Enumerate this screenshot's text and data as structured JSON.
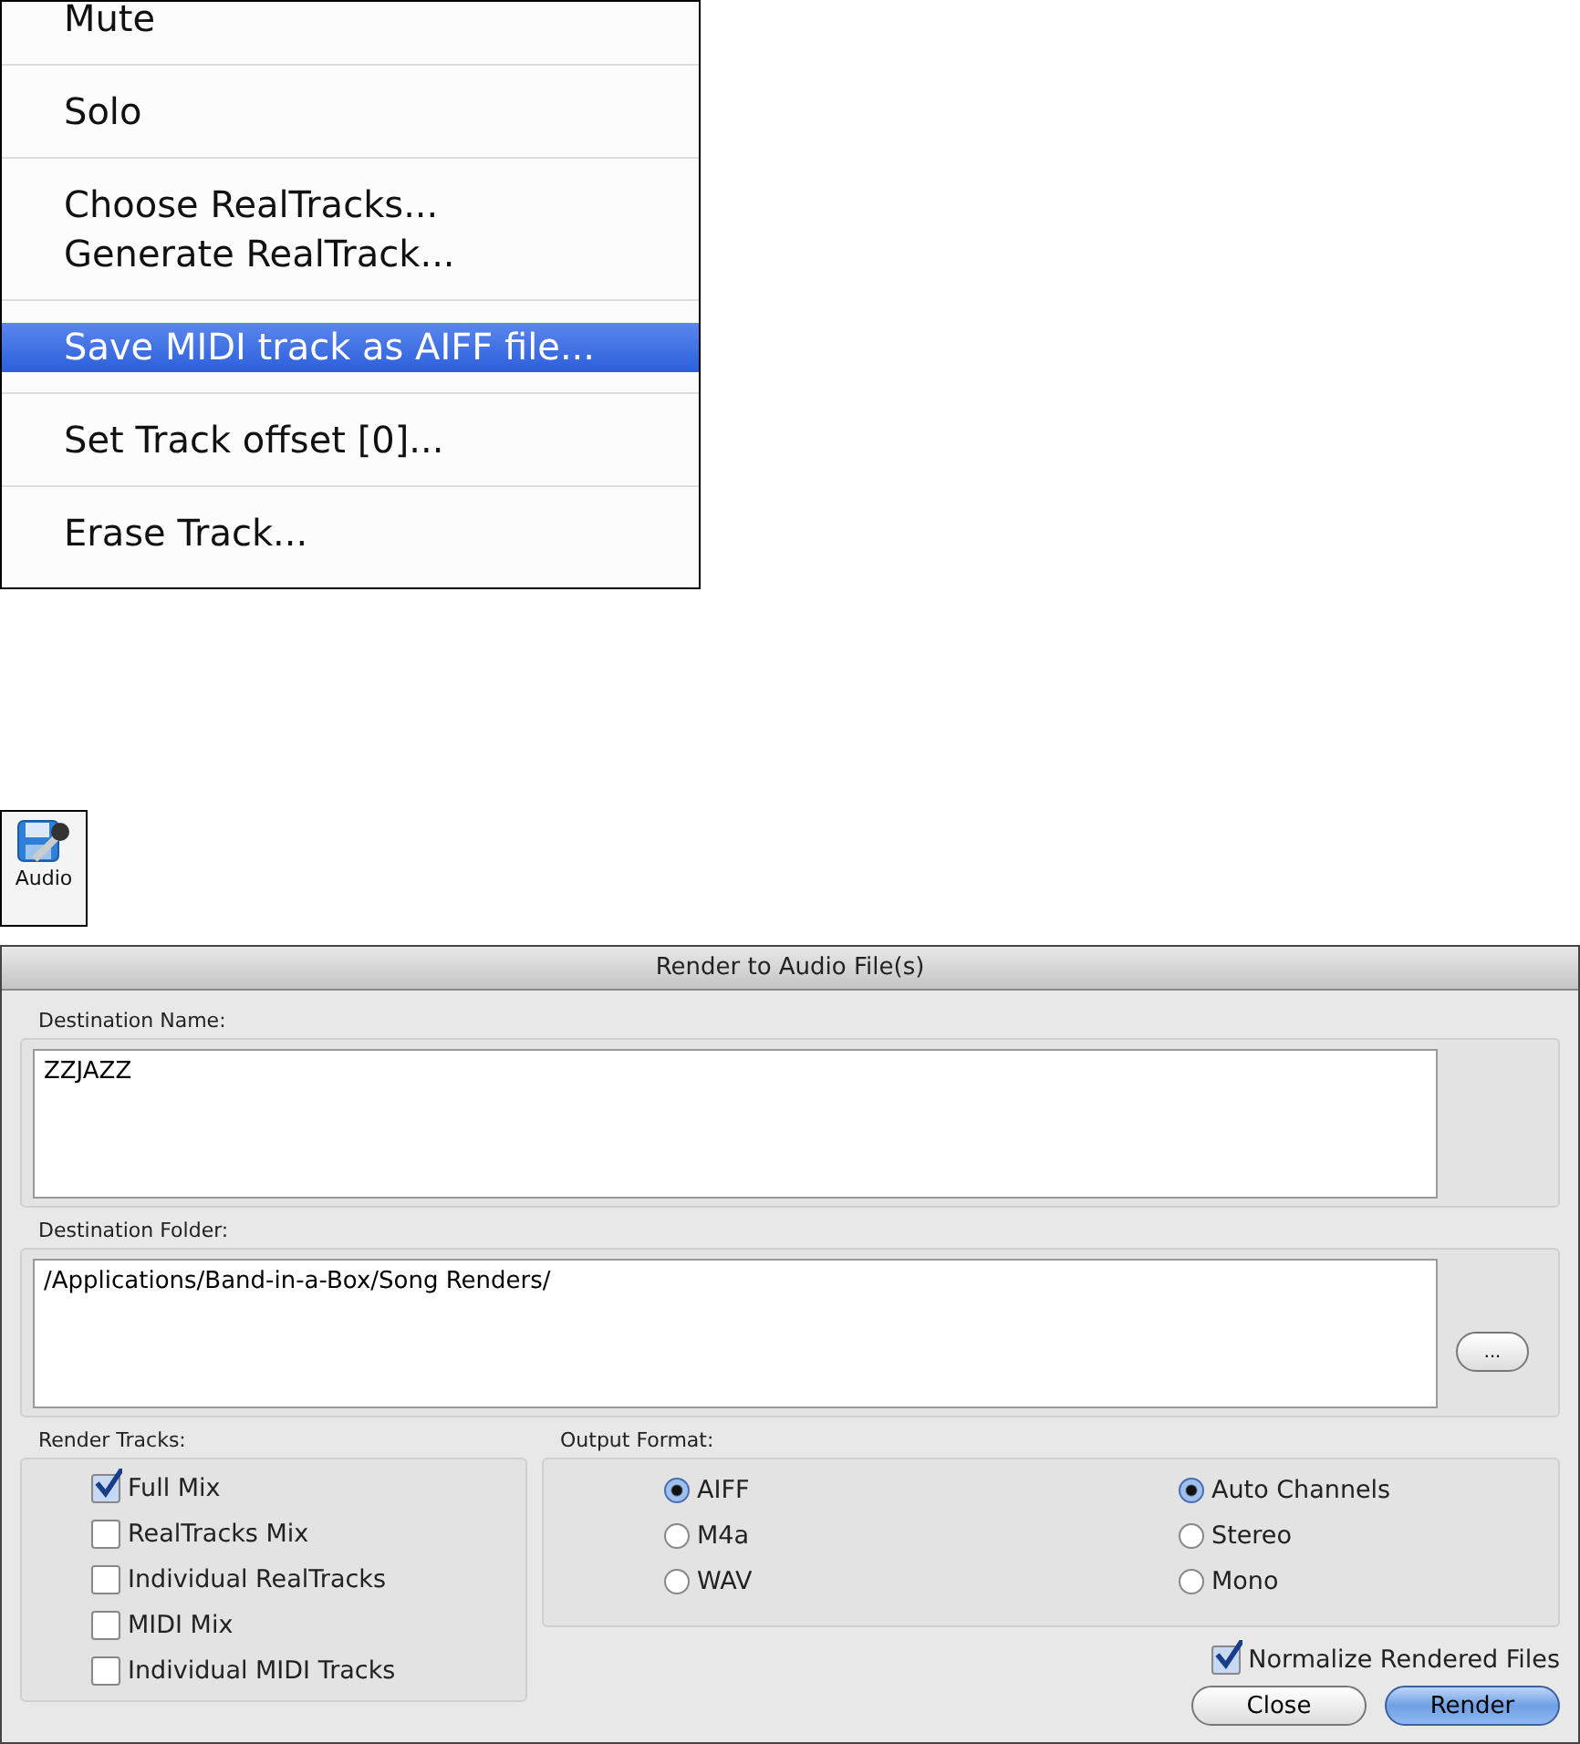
{
  "menu": {
    "groups": [
      {
        "items": [
          {
            "label": "Mute",
            "selected": false
          }
        ]
      },
      {
        "items": [
          {
            "label": "Solo",
            "selected": false
          }
        ]
      },
      {
        "items": [
          {
            "label": "Choose RealTracks...",
            "selected": false
          },
          {
            "label": "Generate RealTrack...",
            "selected": false
          }
        ]
      },
      {
        "items": [
          {
            "label": "Save MIDI track as AIFF file...",
            "selected": true
          }
        ]
      },
      {
        "items": [
          {
            "label": "Set Track offset [0]...",
            "selected": false
          }
        ]
      },
      {
        "items": [
          {
            "label": "Erase Track...",
            "selected": false
          }
        ]
      }
    ]
  },
  "toolbar_button": {
    "label": "Audio"
  },
  "dialog": {
    "title": "Render to Audio File(s)",
    "destination_name": {
      "label": "Destination Name:",
      "value": "ZZJAZZ"
    },
    "destination_folder": {
      "label": "Destination Folder:",
      "value": "/Applications/Band-in-a-Box/Song Renders/",
      "browse": "..."
    },
    "render_tracks": {
      "label": "Render Tracks:",
      "items": [
        {
          "label": "Full Mix",
          "checked": true
        },
        {
          "label": "RealTracks Mix",
          "checked": false
        },
        {
          "label": "Individual RealTracks",
          "checked": false
        },
        {
          "label": "MIDI Mix",
          "checked": false
        },
        {
          "label": "Individual MIDI Tracks",
          "checked": false
        }
      ]
    },
    "output_format": {
      "label": "Output Format:",
      "formats": [
        {
          "label": "AIFF",
          "selected": true
        },
        {
          "label": "M4a",
          "selected": false
        },
        {
          "label": "WAV",
          "selected": false
        }
      ],
      "channels": [
        {
          "label": "Auto Channels",
          "selected": true
        },
        {
          "label": "Stereo",
          "selected": false
        },
        {
          "label": "Mono",
          "selected": false
        }
      ]
    },
    "normalize": {
      "label": "Normalize Rendered Files",
      "checked": true
    },
    "buttons": [
      {
        "label": "Close",
        "kind": "secondary"
      },
      {
        "label": "Render",
        "kind": "default"
      }
    ]
  }
}
